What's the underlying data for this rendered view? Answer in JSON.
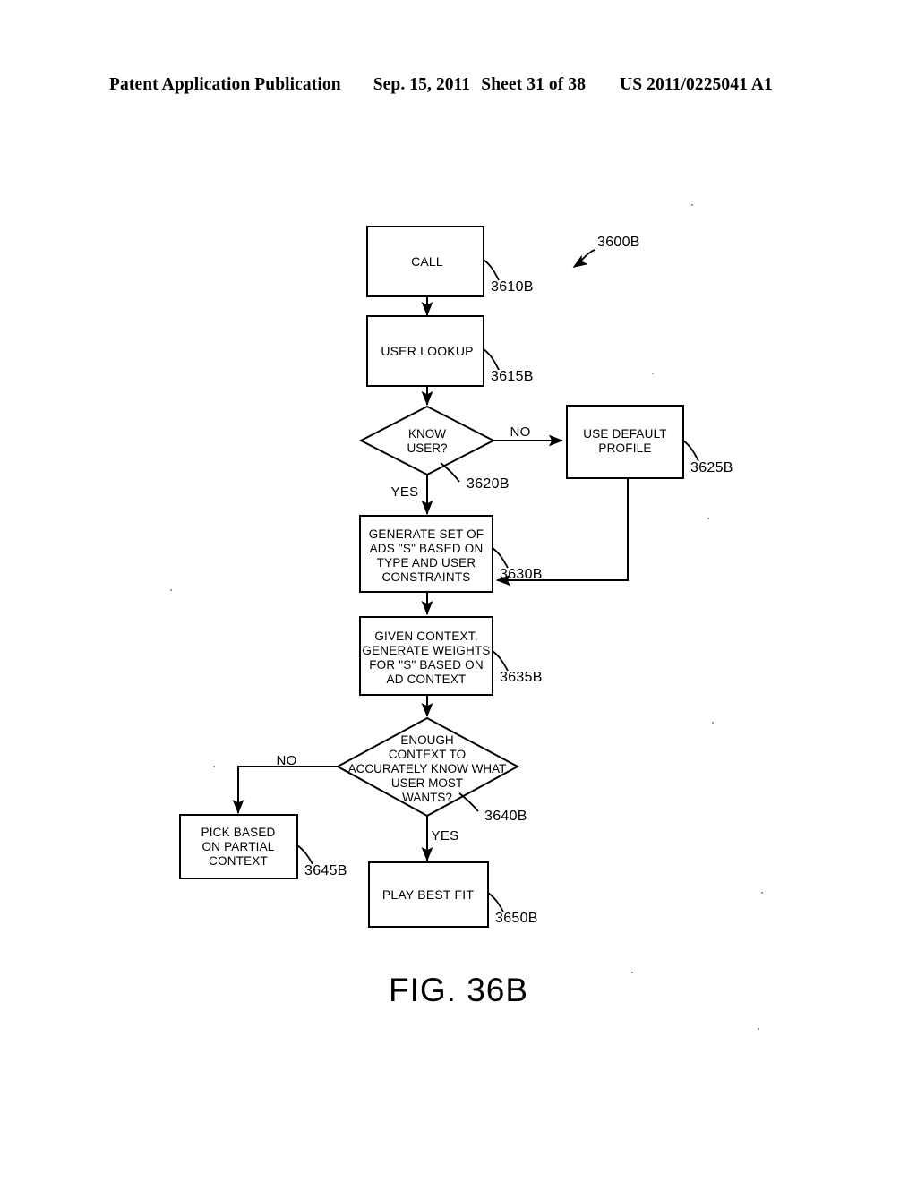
{
  "header": {
    "publication": "Patent Application Publication",
    "date": "Sep. 15, 2011",
    "sheet": "Sheet 31 of 38",
    "number": "US 2011/0225041 A1"
  },
  "figure": {
    "caption": "FIG. 36B",
    "diagram_ref": "3600B"
  },
  "nodes": [
    {
      "id": "call",
      "ref": "3610B",
      "shape": "process",
      "lines": [
        "CALL"
      ]
    },
    {
      "id": "user_lookup",
      "ref": "3615B",
      "shape": "process",
      "lines": [
        "USER LOOKUP"
      ]
    },
    {
      "id": "know_user",
      "ref": "3620B",
      "shape": "decision",
      "lines": [
        "KNOW",
        "USER?"
      ]
    },
    {
      "id": "use_default_profile",
      "ref": "3625B",
      "shape": "process",
      "lines": [
        "USE DEFAULT",
        "PROFILE"
      ]
    },
    {
      "id": "generate_set",
      "ref": "3630B",
      "shape": "process",
      "lines": [
        "GENERATE SET OF",
        "ADS \"S\" BASED ON",
        "TYPE AND USER",
        "CONSTRAINTS"
      ]
    },
    {
      "id": "generate_weights",
      "ref": "3635B",
      "shape": "process",
      "lines": [
        "GIVEN CONTEXT,",
        "GENERATE WEIGHTS",
        "FOR \"S\" BASED ON",
        "AD CONTEXT"
      ]
    },
    {
      "id": "enough_context",
      "ref": "3640B",
      "shape": "decision",
      "lines": [
        "ENOUGH",
        "CONTEXT TO",
        "ACCURATELY KNOW WHAT",
        "USER MOST",
        "WANTS?"
      ]
    },
    {
      "id": "pick_partial",
      "ref": "3645B",
      "shape": "process",
      "lines": [
        "PICK BASED",
        "ON PARTIAL",
        "CONTEXT"
      ]
    },
    {
      "id": "play_best_fit",
      "ref": "3650B",
      "shape": "process",
      "lines": [
        "PLAY BEST FIT"
      ]
    }
  ],
  "branch_labels": {
    "know_user_no": "NO",
    "know_user_yes": "YES",
    "enough_context_no": "NO",
    "enough_context_yes": "YES"
  },
  "colors": {
    "ink": "#000000",
    "paper": "#ffffff"
  }
}
